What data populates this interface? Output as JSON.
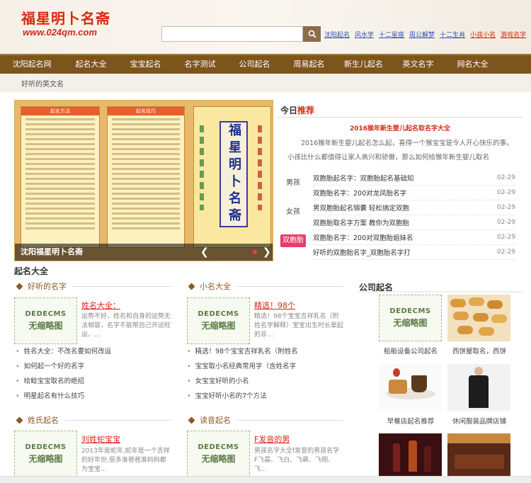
{
  "header": {
    "logo_title": "福星明卜名斋",
    "logo_url": "www.024qm.com",
    "search_placeholder": "",
    "top_links": [
      {
        "label": "沈阳起名",
        "red": false
      },
      {
        "label": "风水学",
        "red": false
      },
      {
        "label": "十二星座",
        "red": false
      },
      {
        "label": "周公解梦",
        "red": false
      },
      {
        "label": "十二生肖",
        "red": false
      },
      {
        "label": "小孩小名",
        "red": true
      },
      {
        "label": "游戏名字",
        "red": true
      }
    ]
  },
  "nav": {
    "items": [
      "沈阳起名网",
      "起名大全",
      "宝宝起名",
      "名字测试",
      "公司起名",
      "周易起名",
      "新生儿起名",
      "英文名字",
      "网名大全"
    ],
    "sub": "好听的英文名"
  },
  "banner": {
    "caption": "沈阳福星明卜名斋",
    "center_text": "福星明卜名斋",
    "left_header": "起名方法",
    "right_header": "起名技巧",
    "colors": {
      "dot_active": "#e83b6a",
      "dot_inactive": "#cccccc"
    }
  },
  "today": {
    "title_prefix": "今日",
    "title_highlight": "推荐",
    "headline": "2016猴年新生婴儿起名取名字大全",
    "summary": "2016猴年新生婴儿起名怎么起，喜得一个猴宝宝是令人开心快乐的事，小孩比什么都值得让家人高兴和骄傲，那么如何给猴年新生婴儿取名",
    "tabs": [
      "男孩",
      "女孩",
      "双胞胎"
    ],
    "news": [
      {
        "title": "双胞胎起名字：双胞胎起名基础知",
        "date": "02-29"
      },
      {
        "title": "双胞胎名字：200对龙凤胎名字",
        "date": "02-29"
      },
      {
        "title": "男双胞胎起名锦囊 轻松搞定双胞",
        "date": "02-29"
      },
      {
        "title": "双胞胎取名字方案 教你为双胞胎",
        "date": "02-29"
      },
      {
        "title": "双胞胎名字：200对双胞胎姐妹名",
        "date": "02-29"
      },
      {
        "title": "好听的双胞胎名字_双胞胎名字打",
        "date": "02-29"
      }
    ]
  },
  "main": {
    "section_title": "起名大全",
    "thumb_line1": "DEDECMS",
    "thumb_line2": "无缩略图",
    "cat1": {
      "heading": "好听的名字",
      "feature_title": "姓名大全：",
      "feature_desc": "运势不好，姓名和自身的运势无法相容，名字不能帮自己开运旺运，…",
      "list": [
        "姓名大全：不改名要如何改运",
        "如何起一个好的名字",
        "给鲶宝宝取名的绝招",
        "明星起名有什么技巧"
      ]
    },
    "cat2": {
      "heading": "小名大全",
      "feature_title": "精选！98个",
      "feature_desc": "精选！98个宝宝吉祥乳名（附姓名学解释）宝宝出生时长辈起的非…",
      "list": [
        "精选！98个宝宝吉祥乳名（附姓名",
        "宝宝取小名经典常用字（含姓名字",
        "女宝宝好听的小名",
        "宝宝好听小名的7个方法"
      ]
    },
    "cat3": {
      "heading": "姓氏起名",
      "feature_title": "刘姓蛇宝宝",
      "feature_desc": "2013年是蛇年,蛇年是一个吉祥的好年份,很多准爸爸准妈妈都为宝宝…"
    },
    "cat4": {
      "heading": "读音起名",
      "feature_title": "F发音的男",
      "feature_desc": "男孩名字大全f发音的男孩名字 F飞晨、飞白、飞飙、飞翔、飞…"
    }
  },
  "company": {
    "title": "公司起名",
    "items": [
      {
        "caption": "船舶设备公司起名",
        "icon": "no-thumbnail"
      },
      {
        "caption": "西饼屋取名，西饼",
        "icon": "cookies-photo"
      },
      {
        "caption": "早餐店起名推荐",
        "icon": "breakfast-photo"
      },
      {
        "caption": "休闲服装品牌店铺",
        "icon": "fashion-photo"
      }
    ]
  },
  "colors": {
    "nav_bg": "#7e541d",
    "accent_red": "#d8281a",
    "link_blue": "#2f4fb4",
    "tab_pink": "#e83b6a"
  }
}
